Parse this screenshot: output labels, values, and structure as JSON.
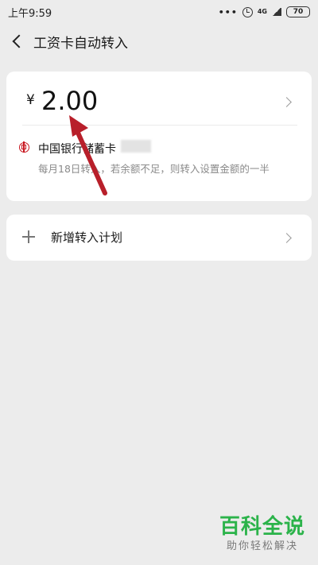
{
  "status_bar": {
    "time": "上午9:59",
    "network": "4G",
    "battery": "70",
    "dots": "•••"
  },
  "header": {
    "title": "工资卡自动转入"
  },
  "transfer_card": {
    "currency_symbol": "¥",
    "amount": "2.00",
    "bank_name": "中国银行储蓄卡",
    "description": "每月18日转入，若余额不足，则转入设置金额的一半"
  },
  "plan_card": {
    "label": "新增转入计划"
  },
  "watermark": {
    "title": "百科全说",
    "subtitle": "助你轻松解决"
  },
  "colors": {
    "background": "#ececec",
    "card": "#ffffff",
    "bank_red": "#c8151e",
    "annotation_arrow": "#b81f2a",
    "watermark_green": "#2bb34a"
  },
  "icons": [
    "back-icon",
    "alarm-icon",
    "bank-logo-icon",
    "plus-icon",
    "chevron-right-icon"
  ]
}
